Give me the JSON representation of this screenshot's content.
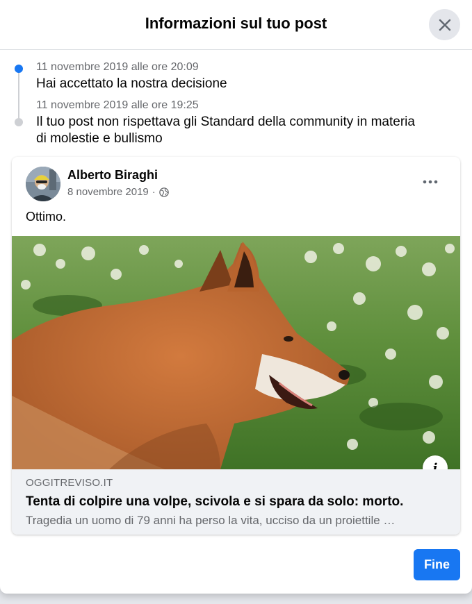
{
  "dialog": {
    "title": "Informazioni sul tuo post"
  },
  "timeline": [
    {
      "date": "11 novembre 2019 alle ore 20:09",
      "text": "Hai accettato la nostra decisione",
      "status": "current"
    },
    {
      "date": "11 novembre 2019 alle ore 19:25",
      "text_line1": "Il tuo post non rispettava gli Standard della community in materia",
      "text_line2": "di molestie e bullismo",
      "status": "past"
    }
  ],
  "post": {
    "author": "Alberto Biraghi",
    "date": "8 novembre 2019",
    "separator": "·",
    "privacy_icon": "globe-icon",
    "text": "Ottimo.",
    "more_icon": "more-options-icon",
    "image_alt": "fox",
    "link": {
      "domain": "OGGITREVISO.IT",
      "title": "Tenta di colpire una volpe, scivola e si spara da solo: morto.",
      "description": "Tragedia un uomo di 79 anni ha perso la vita, ucciso da un proiettile …",
      "info_label": "i"
    }
  },
  "footer": {
    "done_label": "Fine"
  },
  "colors": {
    "accent": "#1877f2",
    "secondary_text": "#65676b",
    "divider": "#dadde1"
  }
}
